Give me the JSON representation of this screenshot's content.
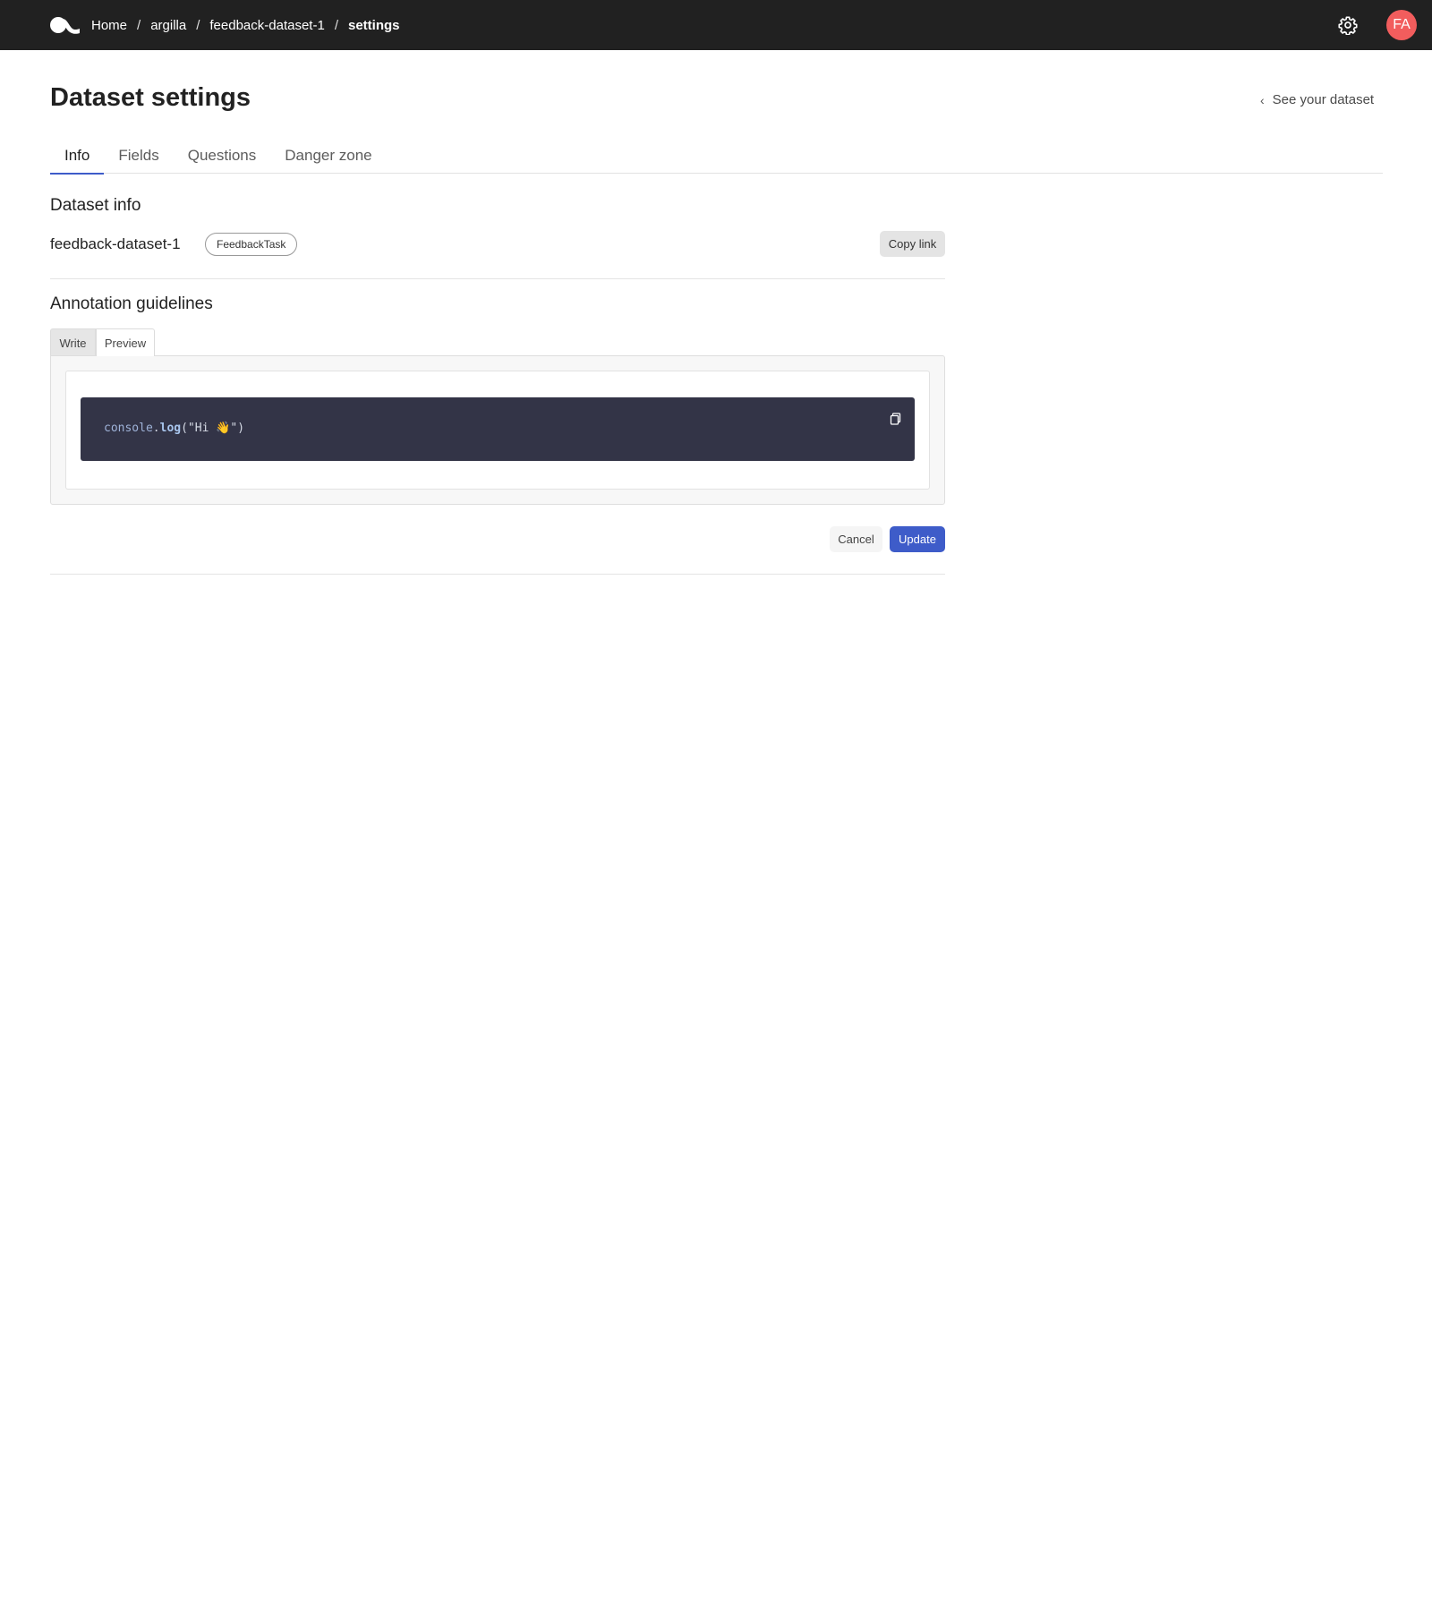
{
  "topbar": {
    "breadcrumbs": [
      "Home",
      "argilla",
      "feedback-dataset-1",
      "settings"
    ],
    "separator": "/",
    "settings_icon": "gear-icon",
    "avatar_initials": "FA",
    "avatar_color": "#f25d5d",
    "background": "#212121"
  },
  "header": {
    "title": "Dataset settings",
    "back_link": "See your dataset"
  },
  "tabs": [
    {
      "label": "Info",
      "active": true
    },
    {
      "label": "Fields",
      "active": false
    },
    {
      "label": "Questions",
      "active": false
    },
    {
      "label": "Danger zone",
      "active": false
    }
  ],
  "dataset_info": {
    "section_title": "Dataset info",
    "name": "feedback-dataset-1",
    "task_badge": "FeedbackTask",
    "copy_link_label": "Copy link"
  },
  "guidelines": {
    "section_title": "Annotation guidelines",
    "editor_tabs": [
      {
        "label": "Write",
        "active": false
      },
      {
        "label": "Preview",
        "active": true
      }
    ],
    "code": {
      "object": "console",
      "dot": ".",
      "function": "log",
      "argument": "(\"Hi 👋\")"
    },
    "copy_code_icon": "copy-icon"
  },
  "actions": {
    "cancel_label": "Cancel",
    "update_label": "Update"
  },
  "colors": {
    "accent": "#3e5cc9",
    "code_background": "#333447"
  }
}
